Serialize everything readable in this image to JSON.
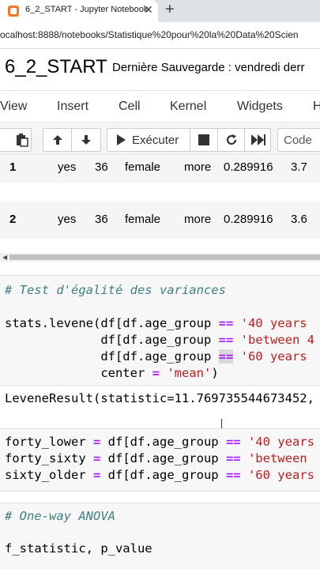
{
  "browser": {
    "tab_title": "6_2_START - Jupyter Notebook",
    "tab_close": "✕",
    "new_tab": "+",
    "url": "ocalhost:8888/notebooks/Statistique%20pour%20la%20Data%20Scien"
  },
  "notebook": {
    "title": "6_2_START",
    "saved_label": "Dernière Sauvegarde : vendredi derr"
  },
  "menu": [
    "View",
    "Insert",
    "Cell",
    "Kernel",
    "Widgets",
    "H"
  ],
  "toolbar": {
    "run_label": "Exécuter",
    "cell_type": "Code"
  },
  "dataframe": {
    "rows": [
      [
        "1",
        "yes",
        "36",
        "female",
        "more",
        "0.289916",
        "3.7"
      ],
      [
        "2",
        "yes",
        "36",
        "female",
        "more",
        "0.289916",
        "3.6"
      ]
    ]
  },
  "cells": {
    "levene": {
      "comment": "# Test d'égalité des variances",
      "line1_prefix": "stats.levene(df[df.age_group ",
      "line1_op": "==",
      "line1_str": " '40 years",
      "line2_prefix": "             df[df.age_group ",
      "line2_op": "==",
      "line2_str": " 'between 4",
      "line3_prefix": "             df[df.age_group ",
      "line3_op": "==",
      "line3_str": " '60 years",
      "line4_prefix": "             center ",
      "line4_op": "=",
      "line4_str": " 'mean'",
      "line4_suffix": ")",
      "output": "LeveneResult(statistic=11.769735544673452,"
    },
    "groups": {
      "line1_var": "forty_lower ",
      "line1_mid": " df[df.age_group ",
      "line1_str": " '40 years",
      "line2_var": "forty_sixty ",
      "line2_mid": " df[df.age_group ",
      "line2_str": " 'between ",
      "line3_var": "sixty_older ",
      "line3_mid": " df[df.age_group ",
      "line3_str": " '60 years",
      "eq": "=",
      "eqeq": "=="
    },
    "anova": {
      "comment": "# One-way ANOVA",
      "line1": "f_statistic, p_value"
    }
  }
}
